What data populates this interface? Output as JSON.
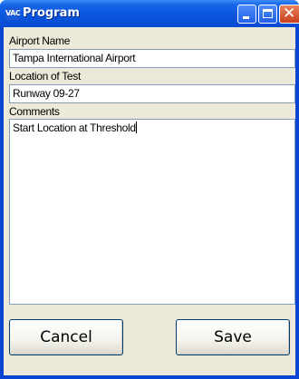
{
  "window": {
    "title": "Program",
    "app_icon_text": "VAC",
    "controls": {
      "minimize": "minimize-icon",
      "maximize": "maximize-icon",
      "close": "close-icon"
    },
    "colors": {
      "titlebar": "#0a55de",
      "client": "#ece9d8",
      "close_button": "#d4502a"
    }
  },
  "form": {
    "airport_name": {
      "label": "Airport Name",
      "value": "Tampa International Airport"
    },
    "location_of_test": {
      "label": "Location of Test",
      "value": "Runway 09-27"
    },
    "comments": {
      "label": "Comments",
      "value": "Start Location at Threshold"
    }
  },
  "buttons": {
    "cancel_label": "Cancel",
    "save_label": "Save"
  }
}
